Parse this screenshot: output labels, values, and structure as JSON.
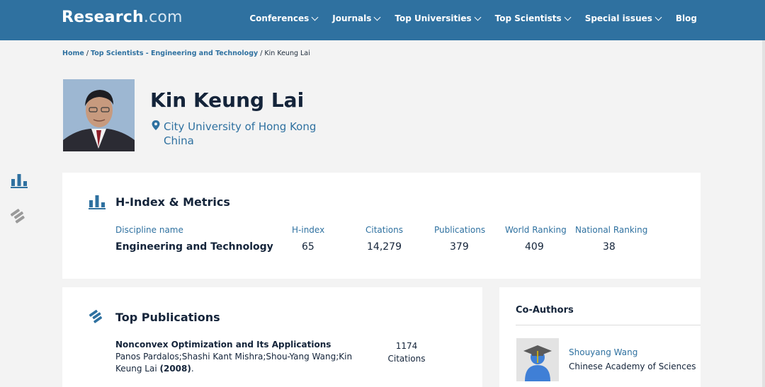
{
  "header": {
    "logo_main": "Research",
    "logo_suffix": ".com",
    "nav": [
      {
        "label": "Conferences"
      },
      {
        "label": "Journals"
      },
      {
        "label": "Top Universities"
      },
      {
        "label": "Top Scientists"
      },
      {
        "label": "Special issues"
      },
      {
        "label": "Blog"
      }
    ]
  },
  "breadcrumb": {
    "home": "Home",
    "section": "Top Scientists - Engineering and Technology",
    "current": "Kin Keung Lai",
    "separator": "/"
  },
  "profile": {
    "name": "Kin Keung Lai",
    "university": "City University of Hong Kong",
    "country": "China"
  },
  "metrics": {
    "title": "H-Index & Metrics",
    "labels": {
      "discipline": "Discipline name",
      "hindex": "H-index",
      "citations": "Citations",
      "publications": "Publications",
      "world_ranking": "World Ranking",
      "national_ranking": "National Ranking"
    },
    "values": {
      "discipline": "Engineering and Technology",
      "hindex": "65",
      "citations": "14,279",
      "publications": "379",
      "world_ranking": "409",
      "national_ranking": "38"
    }
  },
  "publications": {
    "title": "Top Publications",
    "items": [
      {
        "title": "Nonconvex Optimization and Its Applications",
        "authors": "Panos Pardalos;Shashi Kant Mishra;Shou-Yang Wang;Kin Keung Lai",
        "year": "(2008)",
        "after_year": ".",
        "citations_count": "1174",
        "citations_label": "Citations"
      }
    ]
  },
  "coauthors": {
    "title": "Co-Authors",
    "items": [
      {
        "name": "Shouyang Wang",
        "institution": "Chinese Academy of Sciences"
      }
    ]
  },
  "colors": {
    "header_bg": "#2f71a0",
    "link": "#2f71a0",
    "text_dark": "#14243a",
    "page_bg": "#f3f3f3"
  }
}
